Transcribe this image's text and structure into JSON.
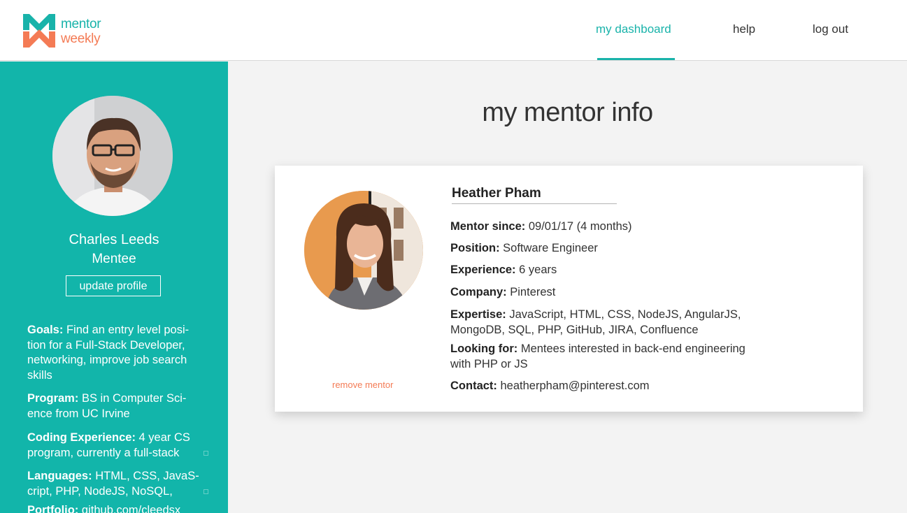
{
  "brand": {
    "line1": "mentor",
    "line2": "weekly",
    "colors": {
      "teal": "#19b3aa",
      "orange": "#f47b55"
    }
  },
  "nav": {
    "dashboard": "my dashboard",
    "help": "help",
    "logout": "log out",
    "active": "my dashboard"
  },
  "sidebar": {
    "name": "Charles Leeds",
    "role": "Mentee",
    "update_button": "update profile",
    "goals": {
      "label": "Goals:",
      "text": " Find an entry level posi-tion for a Full-Stack Developer, networking, improve job search skills"
    },
    "program": {
      "label": "Program:",
      "text": " BS in Computer Sci-ence from UC Irvine"
    },
    "coding": {
      "label": "Coding Experience:",
      "text": " 4 year CS program, currently a full-stack"
    },
    "languages": {
      "label": "Languages:",
      "text": " HTML, CSS, JavaS-cript, PHP, NodeJS, NoSQL,"
    },
    "portfolio": {
      "label": "Portfolio:",
      "text": " github.com/cleedsx"
    }
  },
  "main": {
    "title": "my mentor info",
    "mentor": {
      "name": "Heather Pham",
      "remove": "remove mentor",
      "fields": {
        "since": {
          "label": "Mentor since:",
          "value": " 09/01/17  (4 months)"
        },
        "position": {
          "label": "Position:",
          "value": " Software Engineer"
        },
        "experience": {
          "label": "Experience:",
          "value": " 6 years"
        },
        "company": {
          "label": "Company:",
          "value": " Pinterest"
        },
        "expertise": {
          "label": "Expertise:",
          "value": " JavaScript, HTML, CSS, NodeJS, AngularJS, MongoDB, SQL, PHP, GitHub, JIRA, Confluence"
        },
        "looking": {
          "label": "Looking for:",
          "value": " Mentees interested in back-end engineering with PHP or JS"
        },
        "contact": {
          "label": "Contact:",
          "value": " heatherpham@pinterest.com"
        }
      }
    }
  }
}
